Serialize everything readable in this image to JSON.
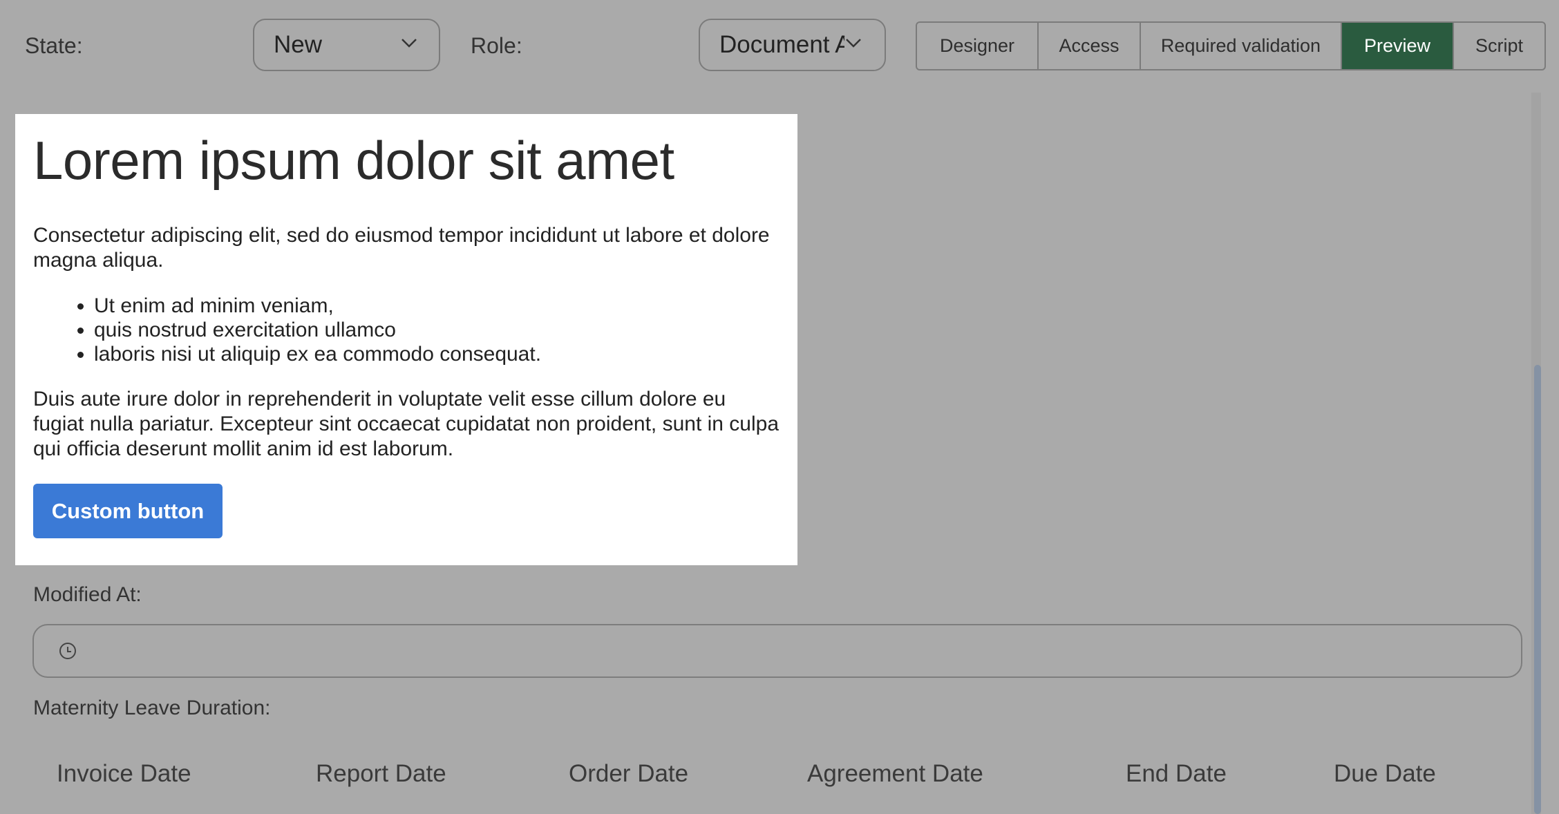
{
  "toolbar": {
    "state_label": "State:",
    "state_value": "New",
    "role_label": "Role:",
    "role_value": "Document Approver",
    "tabs": [
      {
        "label": "Designer",
        "active": false
      },
      {
        "label": "Access",
        "active": false
      },
      {
        "label": "Required validation",
        "active": false
      },
      {
        "label": "Preview",
        "active": true
      },
      {
        "label": "Script",
        "active": false
      }
    ]
  },
  "preview_card": {
    "heading": "Lorem ipsum dolor sit amet",
    "paragraph1": "Consectetur adipiscing elit, sed do eiusmod tempor incididunt ut labore et dolore magna aliqua.",
    "list_items": [
      "Ut enim ad minim veniam,",
      "quis nostrud exercitation ullamco",
      "laboris nisi ut aliquip ex ea commodo consequat."
    ],
    "paragraph2": "Duis aute irure dolor in reprehenderit in voluptate velit esse cillum dolore eu fugiat nulla pariatur. Excepteur sint occaecat cupidatat non proident, sunt in culpa qui officia deserunt mollit anim id est laborum.",
    "button_label": "Custom button"
  },
  "form": {
    "modified_at_label": "Modified At:",
    "modified_at_value": "",
    "maternity_label": "Maternity Leave Duration:",
    "table_headers": [
      "Invoice Date",
      "Report Date",
      "Order Date",
      "Agreement Date",
      "End Date",
      "Due Date"
    ]
  },
  "icons": {
    "chevron": "chevron-down-icon",
    "clock": "clock-icon"
  },
  "colors": {
    "overlay_bg": "#aaaaaa",
    "active_tab": "#2a5b3f",
    "custom_button": "#3b7ad6",
    "card_bg": "#ffffff"
  }
}
